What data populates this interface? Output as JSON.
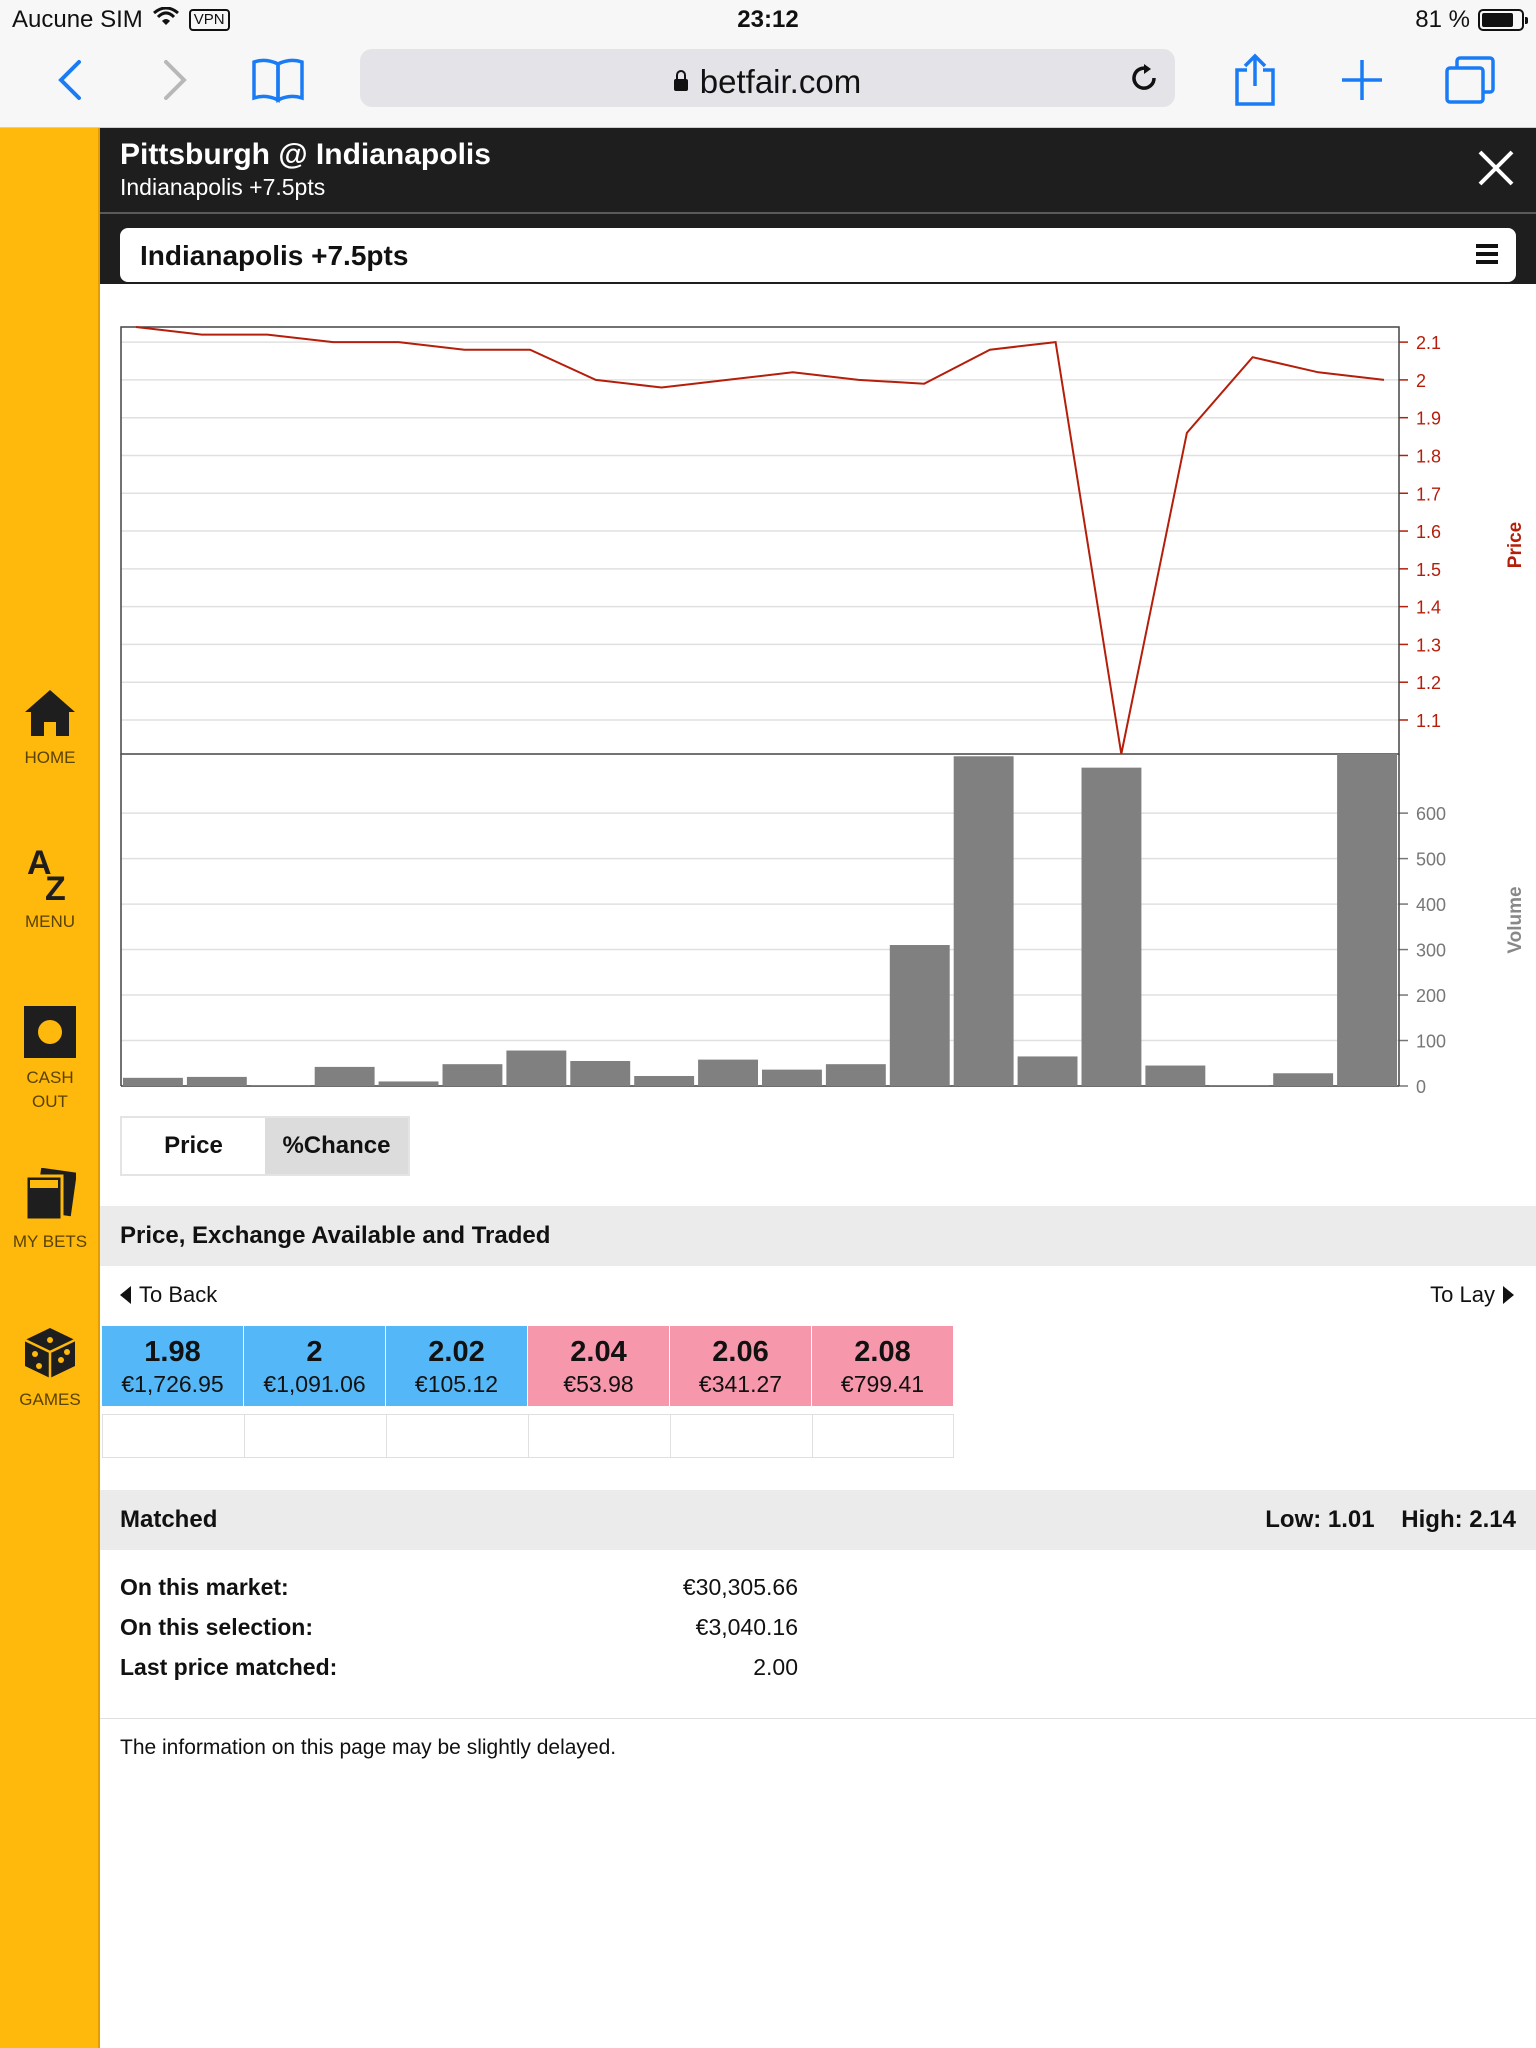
{
  "status_bar": {
    "carrier": "Aucune SIM",
    "vpn": "VPN",
    "time": "23:12",
    "battery": "81 %",
    "battery_level": 0.81
  },
  "browser": {
    "url": "betfair.com"
  },
  "sidebar": {
    "items": [
      {
        "label": "HOME",
        "icon": "home-icon"
      },
      {
        "label": "MENU",
        "icon": "az-icon"
      },
      {
        "label": "CASH\nOUT",
        "icon": "cashout-icon"
      },
      {
        "label": "MY BETS",
        "icon": "bets-icon"
      },
      {
        "label": "GAMES",
        "icon": "dice-icon"
      }
    ]
  },
  "header": {
    "title": "Pittsburgh @ Indianapolis",
    "subtitle": "Indianapolis +7.5pts"
  },
  "selection": {
    "label": "Indianapolis +7.5pts"
  },
  "chart_data": [
    {
      "type": "line",
      "ylabel": "Price",
      "ylim": [
        1.01,
        2.14
      ],
      "yticks": [
        "2.1",
        "2",
        "1.9",
        "1.8",
        "1.7",
        "1.6",
        "1.5",
        "1.4",
        "1.3",
        "1.2",
        "1.1"
      ],
      "x": [
        0,
        1,
        2,
        3,
        4,
        5,
        6,
        7,
        8,
        9,
        10,
        11,
        12,
        13,
        14,
        15,
        16,
        17,
        18,
        19
      ],
      "values": [
        2.14,
        2.12,
        2.12,
        2.1,
        2.1,
        2.08,
        2.08,
        2.0,
        1.98,
        2.0,
        2.02,
        2.0,
        1.99,
        2.08,
        2.1,
        1.01,
        1.86,
        2.06,
        2.02,
        2.0
      ],
      "color": "#b41e0a"
    },
    {
      "type": "bar",
      "ylabel": "Volume",
      "ylim": [
        0,
        730
      ],
      "yticks": [
        "0",
        "100",
        "200",
        "300",
        "400",
        "500",
        "600"
      ],
      "values": [
        18,
        20,
        2,
        42,
        10,
        48,
        78,
        55,
        22,
        58,
        36,
        48,
        310,
        725,
        65,
        700,
        45,
        2,
        28,
        730
      ],
      "color": "#808080"
    }
  ],
  "toggle": {
    "price": "Price",
    "chance": "%Chance"
  },
  "exchange": {
    "title": "Price, Exchange Available and Traded",
    "to_back": "To Back",
    "to_lay": "To Lay",
    "back": [
      {
        "price": "1.98",
        "amount": "€1,726.95"
      },
      {
        "price": "2",
        "amount": "€1,091.06"
      },
      {
        "price": "2.02",
        "amount": "€105.12"
      }
    ],
    "lay": [
      {
        "price": "2.04",
        "amount": "€53.98"
      },
      {
        "price": "2.06",
        "amount": "€341.27"
      },
      {
        "price": "2.08",
        "amount": "€799.41"
      }
    ]
  },
  "matched": {
    "title": "Matched",
    "low": "Low: 1.01",
    "high": "High: 2.14",
    "market_label": "On this market:",
    "market_value": "€30,305.66",
    "selection_label": "On this selection:",
    "selection_value": "€3,040.16",
    "last_label": "Last price matched:",
    "last_value": "2.00"
  },
  "disclaimer": "The information on this page may be slightly delayed."
}
